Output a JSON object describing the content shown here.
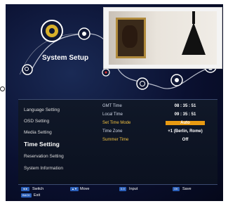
{
  "menu_title": "System Setup",
  "menu": {
    "items": [
      {
        "label": "Language Setting",
        "active": false
      },
      {
        "label": "OSD Setting",
        "active": false
      },
      {
        "label": "Media Setting",
        "active": false
      },
      {
        "label": "Time Setting",
        "active": true
      },
      {
        "label": "Reservation Setting",
        "active": false
      },
      {
        "label": "System Information",
        "active": false
      }
    ]
  },
  "settings": [
    {
      "label": "GMT Time",
      "value": "08 : 35 : 51"
    },
    {
      "label": "Local Time",
      "value": "09 : 35 : 51"
    },
    {
      "label": "Set Time Mode",
      "value": "Auto",
      "selected": true
    },
    {
      "label": "Time Zone",
      "value": "+1 (Berlin, Rome)"
    },
    {
      "label": "Summer Time",
      "value": "Off"
    }
  ],
  "footer": {
    "switch": {
      "key": "◄►",
      "label": "Switch"
    },
    "move": {
      "key": "▲▼",
      "label": "Move"
    },
    "input": {
      "key": "0-9",
      "label": "Input"
    },
    "save": {
      "key": "OK",
      "label": "Save"
    },
    "exit": {
      "key": "BACK",
      "label": "Exit"
    }
  },
  "colors": {
    "accent": "#e89a12",
    "panel": "#0b1120",
    "key": "#2b5fb8"
  }
}
